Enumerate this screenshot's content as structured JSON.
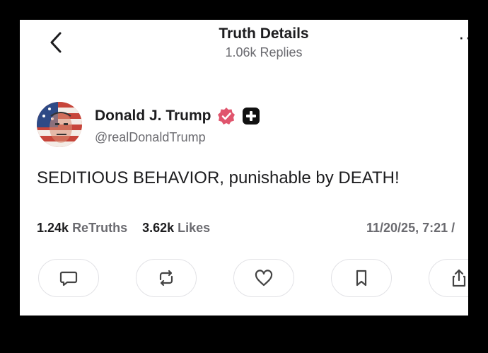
{
  "header": {
    "title": "Truth Details",
    "subtitle": "1.06k Replies",
    "back_icon": "chevron-left-icon",
    "more_icon": "more-dots-icon"
  },
  "post": {
    "author_name": "Donald J. Trump",
    "handle": "@realDonaldTrump",
    "verified_color": "#e0556d",
    "text": "SEDITIOUS BEHAVIOR, punishable by DEATH!",
    "retruths_count": "1.24k",
    "retruths_label": "ReTruths",
    "likes_count": "3.62k",
    "likes_label": "Likes",
    "timestamp": "11/20/25, 7:21 /"
  },
  "actions": [
    "reply-icon",
    "retruth-icon",
    "like-icon",
    "bookmark-icon",
    "share-icon"
  ]
}
